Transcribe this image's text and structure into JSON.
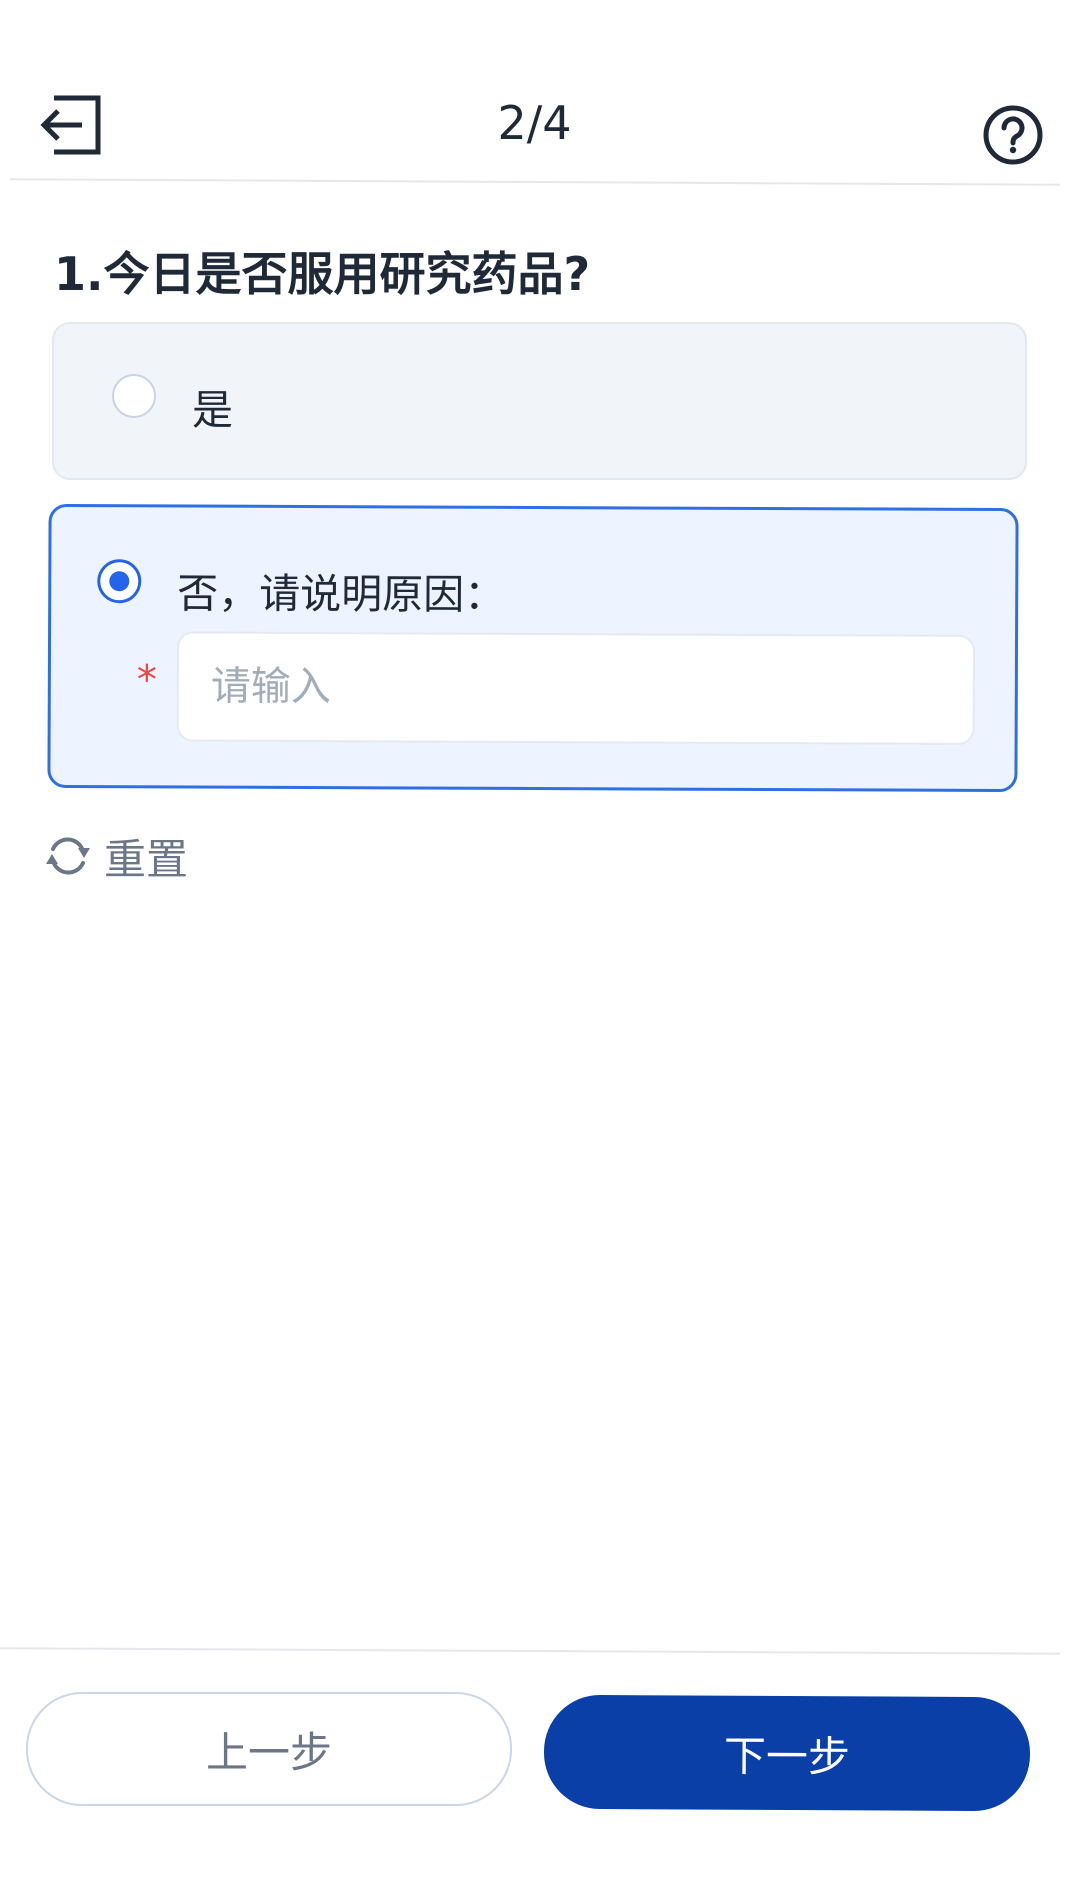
{
  "header": {
    "step_counter": "2/4"
  },
  "question": {
    "title": "1.今日是否服用研究药品?",
    "options": [
      {
        "label": "是",
        "selected": false
      },
      {
        "label": "否，请说明原因：",
        "selected": true
      }
    ],
    "reason_input": {
      "value": "",
      "placeholder": "请输入",
      "required_mark": "*"
    }
  },
  "reset": {
    "label": "重置"
  },
  "footer": {
    "prev_label": "上一步",
    "next_label": "下一步"
  },
  "colors": {
    "primary": "#2563eb",
    "button_primary": "#0a3fa8",
    "required": "#ef4444",
    "option_bg": "#f1f4f9",
    "option_selected_bg": "#edf3ff"
  },
  "icons": {
    "exit": "exit-icon",
    "help": "help-icon",
    "reset": "refresh-icon"
  }
}
